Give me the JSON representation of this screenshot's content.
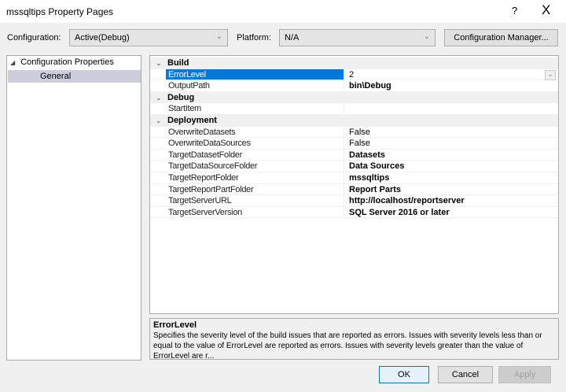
{
  "window": {
    "title": "mssqltips Property Pages",
    "help": "?",
    "close": "X"
  },
  "config": {
    "label": "Configuration:",
    "value": "Active(Debug)",
    "platform_label": "Platform:",
    "platform_value": "N/A",
    "manager_button": "Configuration Manager..."
  },
  "tree": {
    "root": "Configuration Properties",
    "child": "General"
  },
  "grid": {
    "categories": [
      {
        "name": "Build",
        "props": [
          {
            "name": "ErrorLevel",
            "value": "2",
            "bold": false,
            "selected": true
          },
          {
            "name": "OutputPath",
            "value": "bin\\Debug",
            "bold": true
          }
        ]
      },
      {
        "name": "Debug",
        "props": [
          {
            "name": "StartItem",
            "value": "",
            "bold": false
          }
        ]
      },
      {
        "name": "Deployment",
        "props": [
          {
            "name": "OverwriteDatasets",
            "value": "False",
            "bold": false
          },
          {
            "name": "OverwriteDataSources",
            "value": "False",
            "bold": false
          },
          {
            "name": "TargetDatasetFolder",
            "value": "Datasets",
            "bold": true
          },
          {
            "name": "TargetDataSourceFolder",
            "value": "Data Sources",
            "bold": true
          },
          {
            "name": "TargetReportFolder",
            "value": "mssqltips",
            "bold": true
          },
          {
            "name": "TargetReportPartFolder",
            "value": "Report Parts",
            "bold": true
          },
          {
            "name": "TargetServerURL",
            "value": "http://localhost/reportserver",
            "bold": true
          },
          {
            "name": "TargetServerVersion",
            "value": "SQL Server 2016 or later",
            "bold": true
          }
        ]
      }
    ]
  },
  "description": {
    "title": "ErrorLevel",
    "text": "Specifies the severity level of the build issues that are reported as errors. Issues with severity levels less than or equal to the value of ErrorLevel are reported as errors. Issues with severity levels greater than the value of ErrorLevel are r..."
  },
  "buttons": {
    "ok": "OK",
    "cancel": "Cancel",
    "apply": "Apply"
  }
}
